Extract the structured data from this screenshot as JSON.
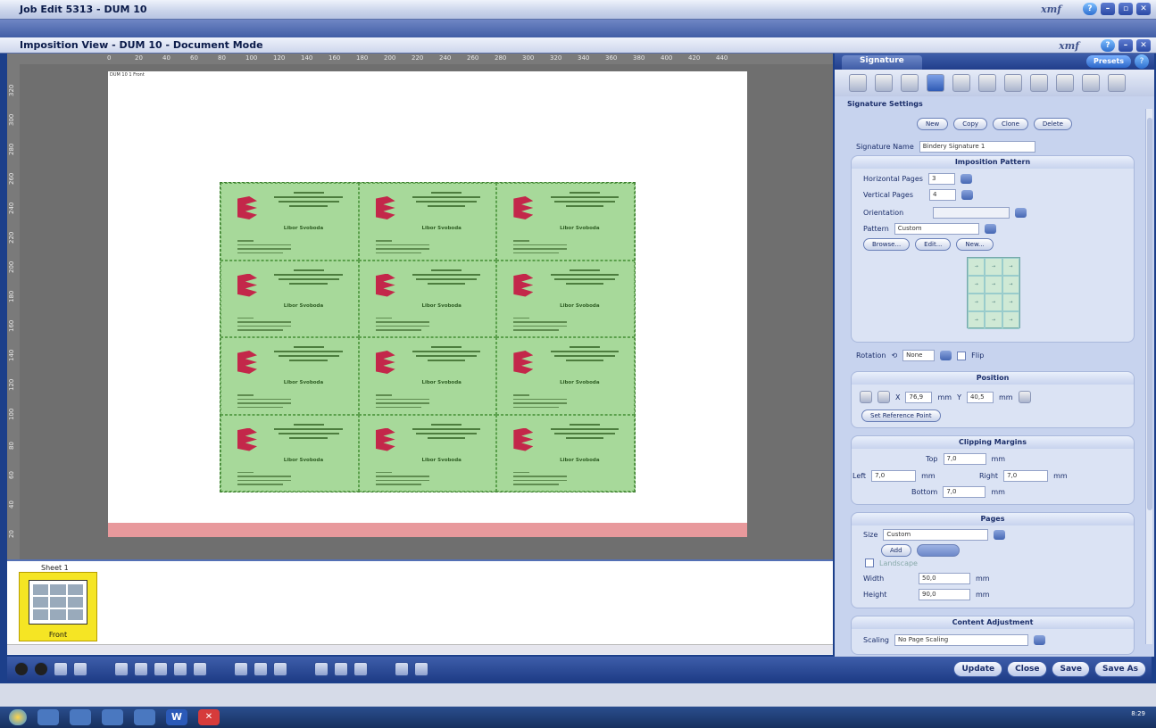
{
  "window": {
    "title": "Job Edit 5313 - DUM 10",
    "subtitle": "Imposition View - DUM 10 - Document Mode",
    "brand": "xmf"
  },
  "rulers": {
    "top": [
      "0",
      "20",
      "40",
      "60",
      "80",
      "100",
      "120",
      "140",
      "160",
      "180",
      "200",
      "220",
      "240",
      "260",
      "280",
      "300",
      "320",
      "340",
      "360",
      "380",
      "400",
      "420",
      "440"
    ],
    "left": [
      "320",
      "300",
      "280",
      "260",
      "240",
      "220",
      "200",
      "180",
      "160",
      "140",
      "120",
      "100",
      "80",
      "60",
      "40",
      "20"
    ]
  },
  "sheet": {
    "label": "DUM 10 1 Front",
    "card_name": "Libor Svoboda"
  },
  "thumbnails": {
    "sheet_title": "Sheet 1",
    "front_label": "Front"
  },
  "panel": {
    "tab": "Signature",
    "presets": "Presets",
    "section_title": "Signature Settings",
    "buttons": {
      "new": "New",
      "copy": "Copy",
      "clone": "Clone",
      "delete": "Delete"
    },
    "signature_name_label": "Signature Name",
    "signature_name_value": "Bindery Signature 1",
    "imposition_pattern": {
      "header": "Imposition Pattern",
      "horizontal_label": "Horizontal Pages",
      "horizontal_value": "3",
      "vertical_label": "Vertical Pages",
      "vertical_value": "4",
      "orientation_label": "Orientation",
      "orientation_value": "",
      "pattern_label": "Pattern",
      "pattern_value": "Custom",
      "browse": "Browse...",
      "edit": "Edit...",
      "new": "New..."
    },
    "rotation_label": "Rotation",
    "rotation_value": "None",
    "flip_label": "Flip",
    "position": {
      "header": "Position",
      "x_label": "X",
      "x_value": "76,9",
      "x_unit": "mm",
      "y_label": "Y",
      "y_value": "40,5",
      "y_unit": "mm",
      "set_ref": "Set Reference Point"
    },
    "clipping": {
      "header": "Clipping Margins",
      "top_label": "Top",
      "top_value": "7,0",
      "left_label": "Left",
      "left_value": "7,0",
      "right_label": "Right",
      "right_value": "7,0",
      "bottom_label": "Bottom",
      "bottom_value": "7,0",
      "unit": "mm"
    },
    "pages": {
      "header": "Pages",
      "size_label": "Size",
      "size_value": "Custom",
      "add": "Add",
      "landscape": "Landscape",
      "width_label": "Width",
      "width_value": "50,0",
      "height_label": "Height",
      "height_value": "90,0",
      "unit": "mm"
    },
    "content": {
      "header": "Content Adjustment",
      "scaling_label": "Scaling",
      "scaling_value": "No Page Scaling"
    }
  },
  "actions": {
    "update": "Update",
    "close": "Close",
    "save": "Save",
    "save_as": "Save As"
  },
  "taskbar": {
    "time": "8:29"
  }
}
